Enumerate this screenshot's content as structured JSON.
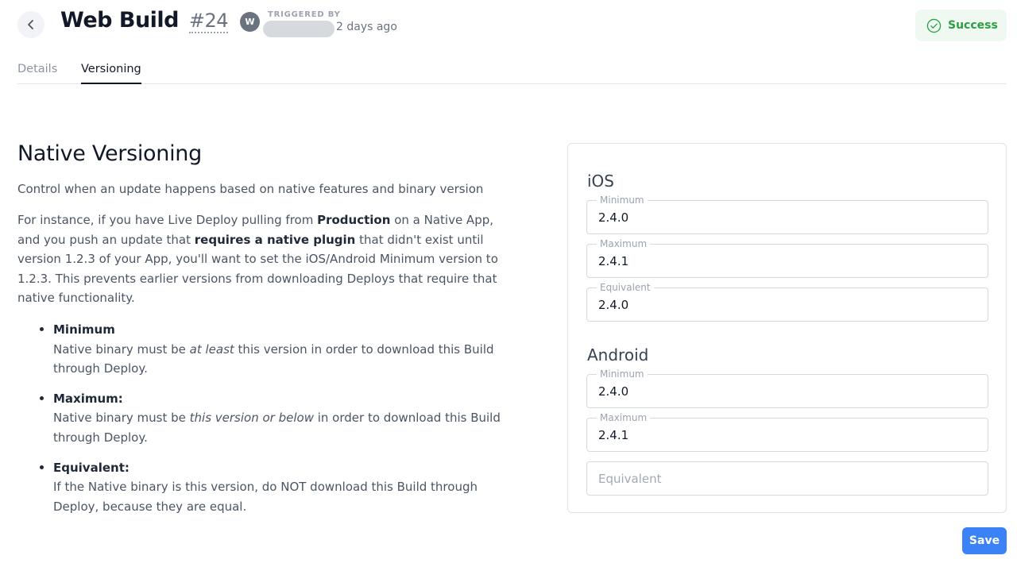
{
  "header": {
    "back_icon": "chevron-left-icon",
    "title": "Web Build",
    "build_number": "#24",
    "avatar_initial": "W",
    "triggered_label": "TRIGGERED BY",
    "triggered_time": "2 days ago",
    "status": "Success",
    "status_icon": "check-circle-icon",
    "status_color": "#2e9e44"
  },
  "tabs": [
    {
      "label": "Details",
      "active": false
    },
    {
      "label": "Versioning",
      "active": true
    }
  ],
  "content": {
    "heading": "Native Versioning",
    "intro": "Control when an update happens based on native features and binary version",
    "para_1": "For instance, if you have Live Deploy pulling from ",
    "para_bold_1": "Production",
    "para_2": " on a Native App, and you push an update that ",
    "para_bold_2": "requires a native plugin",
    "para_3": " that didn't exist until version 1.2.3 of your App, you'll want to set the iOS/Android Minimum version to 1.2.3. This prevents earlier versions from downloading Deploys that require that native functionality.",
    "bullets": [
      {
        "title": "Minimum",
        "desc_1": "Native binary must be ",
        "desc_em": "at least",
        "desc_2": " this version in order to download this Build through Deploy."
      },
      {
        "title": "Maximum:",
        "desc_1": "Native binary must be ",
        "desc_em": "this version or below",
        "desc_2": " in order to download this Build through Deploy."
      },
      {
        "title": "Equivalent:",
        "desc_1": "If the Native binary is this version, do NOT download this Build through Deploy, because they are equal.",
        "desc_em": "",
        "desc_2": ""
      }
    ]
  },
  "ios": {
    "label": "iOS",
    "minimum_label": "Minimum",
    "minimum_value": "2.4.0",
    "maximum_label": "Maximum",
    "maximum_value": "2.4.1",
    "equivalent_label": "Equivalent",
    "equivalent_value": "2.4.0"
  },
  "android": {
    "label": "Android",
    "minimum_label": "Minimum",
    "minimum_value": "2.4.0",
    "maximum_label": "Maximum",
    "maximum_value": "2.4.1",
    "equivalent_placeholder": "Equivalent",
    "equivalent_value": ""
  },
  "save_label": "Save",
  "accent_color": "#3b82f6"
}
